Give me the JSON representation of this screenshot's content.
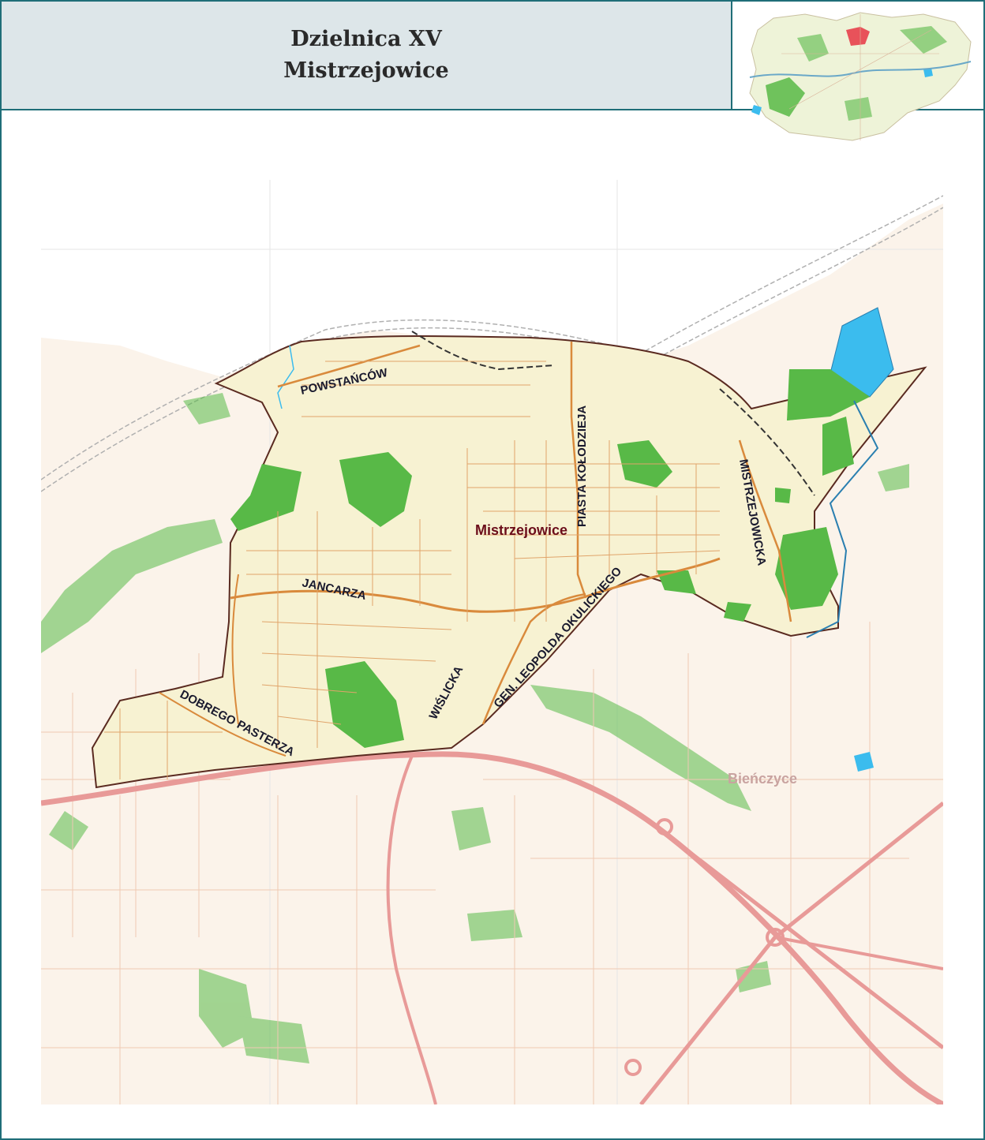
{
  "header": {
    "title_line1": "Dzielnica XV",
    "title_line2": "Mistrzejowice"
  },
  "map": {
    "district_name": "Mistrzejowice",
    "neighbor_label": "Bieńczyce",
    "streets": {
      "powstancow": "POWSTAŃCÓW",
      "piasta_kolodzieja": "PIASTA KOŁODZIEJA",
      "mistrzejowicka": "MISTRZEJOWICKA",
      "jancarza": "JANCARZA",
      "wislicka": "WIŚLICKA",
      "okulickiego": "GEN. LEOPOLDA OKULICKIEGO",
      "dobrego_pasterza": "DOBREGO PASTERZA"
    },
    "colors": {
      "district_fill": "#f7f2d2",
      "outside_fill": "#fbf3ea",
      "green": "#58b947",
      "water": "#3bbcee",
      "major_road": "#e89a98",
      "local_road": "#d98a3c",
      "boundary": "#5a2a20"
    }
  }
}
